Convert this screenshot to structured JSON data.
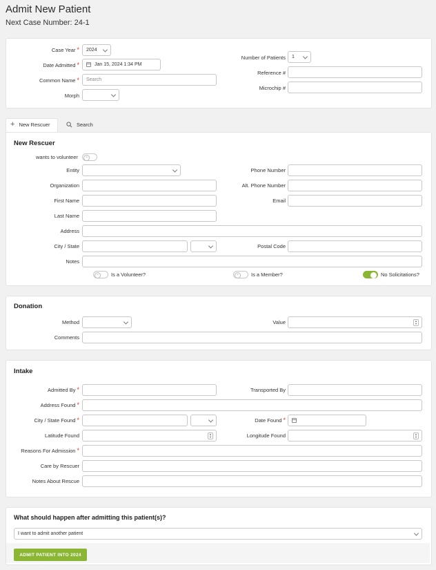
{
  "page": {
    "title": "Admit New Patient",
    "next_case": "Next Case Number: 24-1"
  },
  "top_form": {
    "case_year_label": "Case Year",
    "case_year_value": "2024",
    "date_admitted_label": "Date Admitted",
    "date_admitted_value": "Jan 15, 2024 1:34 PM",
    "common_name_label": "Common Name",
    "common_name_placeholder": "Search",
    "morph_label": "Morph",
    "num_patients_label": "Number of Patients",
    "num_patients_value": "1",
    "reference_label": "Reference #",
    "microchip_label": "Microchip #"
  },
  "tabs": {
    "new_rescuer": "New Rescuer",
    "search": "Search"
  },
  "rescuer": {
    "heading": "New Rescuer",
    "wants_volunteer": "wants to volunteer",
    "entity": "Entity",
    "organization": "Organization",
    "first_name": "First Name",
    "last_name": "Last Name",
    "address": "Address",
    "city_state": "City / State",
    "notes": "Notes",
    "phone": "Phone Number",
    "alt_phone": "Alt. Phone Number",
    "email": "Email",
    "postal": "Postal Code",
    "is_volunteer": "Is a Volunteer?",
    "is_member": "Is a Member?",
    "no_solicitations": "No Solicitations?"
  },
  "donation": {
    "heading": "Donation",
    "method": "Method",
    "value": "Value",
    "comments": "Comments"
  },
  "intake": {
    "heading": "Intake",
    "admitted_by": "Admitted By",
    "transported_by": "Transported By",
    "address_found": "Address Found",
    "city_state_found": "City / State Found",
    "date_found": "Date Found",
    "latitude": "Latitude Found",
    "longitude": "Longitude Found",
    "reasons": "Reasons For Admission",
    "care_by_rescuer": "Care by Rescuer",
    "notes_rescue": "Notes About Rescue"
  },
  "after": {
    "heading": "What should happen after admitting this patient(s)?",
    "selected": "I want to admit another patient",
    "button": "ADMIT PATIENT INTO 2024"
  },
  "colors": {
    "accent": "#8ab634",
    "required": "#dd3333"
  }
}
